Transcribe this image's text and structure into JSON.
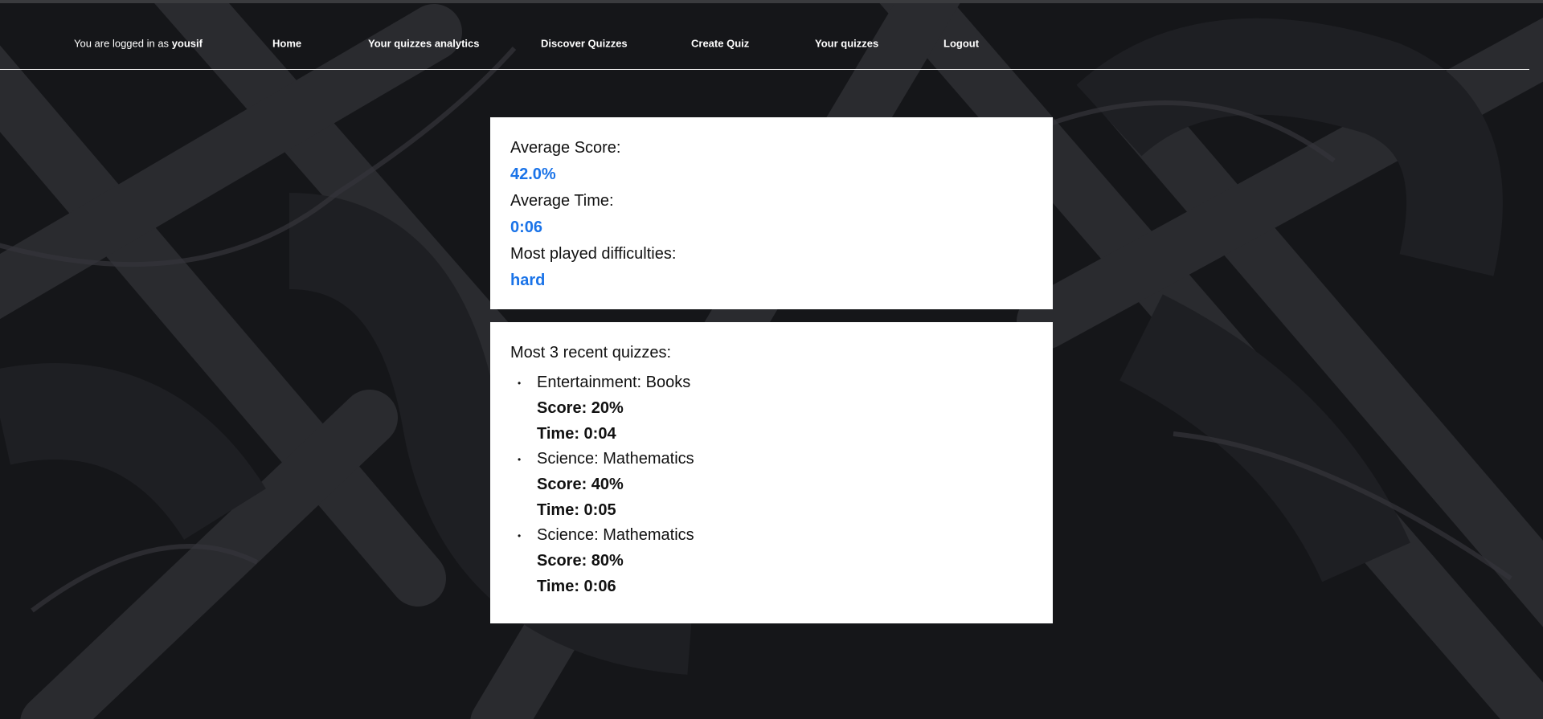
{
  "nav": {
    "logged_in_prefix": "You are logged in as",
    "username": "yousif",
    "items": [
      "Home",
      "Your quizzes analytics",
      "Discover Quizzes",
      "Create Quiz",
      "Your quizzes",
      "Logout"
    ]
  },
  "stats": {
    "average_score_label": "Average Score:",
    "average_score_value": "42.0%",
    "average_time_label": "Average Time:",
    "average_time_value": "0:06",
    "difficulty_label": "Most played difficulties:",
    "difficulty_value": "hard"
  },
  "recent": {
    "title": "Most 3 recent quizzes:",
    "bullet": "•",
    "quizzes": [
      {
        "name": "Entertainment: Books",
        "score": "Score: 20%",
        "time": "Time: 0:04"
      },
      {
        "name": "Science: Mathematics",
        "score": "Score: 40%",
        "time": "Time: 0:05"
      },
      {
        "name": "Science: Mathematics",
        "score": "Score: 80%",
        "time": "Time: 0:06"
      }
    ]
  },
  "colors": {
    "accent": "#1a73e8",
    "background": "#141517",
    "card": "#ffffff"
  }
}
